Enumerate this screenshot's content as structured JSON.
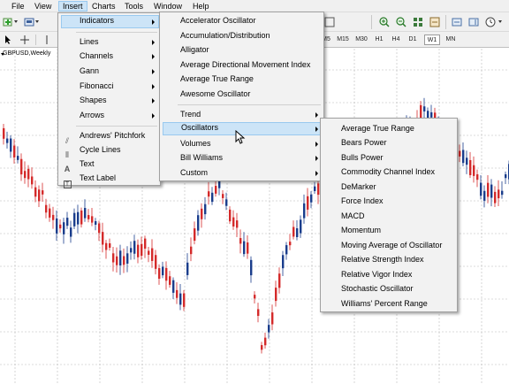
{
  "menubar": {
    "items": [
      {
        "label": "File",
        "active": false
      },
      {
        "label": "View",
        "active": false
      },
      {
        "label": "Insert",
        "active": true
      },
      {
        "label": "Charts",
        "active": false
      },
      {
        "label": "Tools",
        "active": false
      },
      {
        "label": "Window",
        "active": false
      },
      {
        "label": "Help",
        "active": false
      }
    ]
  },
  "timeframes": [
    "M5",
    "M15",
    "M30",
    "H1",
    "H4",
    "D1",
    "W1",
    "MN"
  ],
  "selected_timeframe": "W1",
  "chart": {
    "symbol": "GBPUSD,Weekly"
  },
  "insert_menu": {
    "items": [
      {
        "label": "Indicators",
        "submenu": true,
        "highlighted": true
      },
      {
        "label": "Lines",
        "submenu": true
      },
      {
        "label": "Channels",
        "submenu": true
      },
      {
        "label": "Gann",
        "submenu": true
      },
      {
        "label": "Fibonacci",
        "submenu": true
      },
      {
        "label": "Shapes",
        "submenu": true
      },
      {
        "label": "Arrows",
        "submenu": true
      },
      {
        "label": "Andrews' Pitchfork",
        "icon": "pitchfork-icon"
      },
      {
        "label": "Cycle Lines",
        "icon": "cycle-lines-icon"
      },
      {
        "label": "Text",
        "icon": "text-icon"
      },
      {
        "label": "Text Label",
        "icon": "text-label-icon"
      }
    ]
  },
  "indicators_menu": {
    "items": [
      {
        "label": "Accelerator Oscillator"
      },
      {
        "label": "Accumulation/Distribution"
      },
      {
        "label": "Alligator"
      },
      {
        "label": "Average Directional Movement Index"
      },
      {
        "label": "Average True Range"
      },
      {
        "label": "Awesome Oscillator"
      },
      {
        "label": "Trend",
        "submenu": true
      },
      {
        "label": "Oscillators",
        "submenu": true,
        "highlighted": true
      },
      {
        "label": "Volumes",
        "submenu": true
      },
      {
        "label": "Bill Williams",
        "submenu": true
      },
      {
        "label": "Custom",
        "submenu": true
      }
    ]
  },
  "oscillators_menu": {
    "items": [
      {
        "label": "Average True Range"
      },
      {
        "label": "Bears Power"
      },
      {
        "label": "Bulls Power"
      },
      {
        "label": "Commodity Channel Index"
      },
      {
        "label": "DeMarker"
      },
      {
        "label": "Force Index"
      },
      {
        "label": "MACD"
      },
      {
        "label": "Momentum"
      },
      {
        "label": "Moving Average of Oscillator"
      },
      {
        "label": "Relative Strength Index"
      },
      {
        "label": "Relative Vigor Index"
      },
      {
        "label": "Stochastic Oscillator"
      },
      {
        "label": "Williams' Percent Range"
      }
    ]
  },
  "colors": {
    "bull_candle": "#1a3d8c",
    "bear_candle": "#d42a2a",
    "highlight": "#cce4f7",
    "highlight_border": "#99c9ef",
    "menu_bg": "#f2f2f2"
  }
}
